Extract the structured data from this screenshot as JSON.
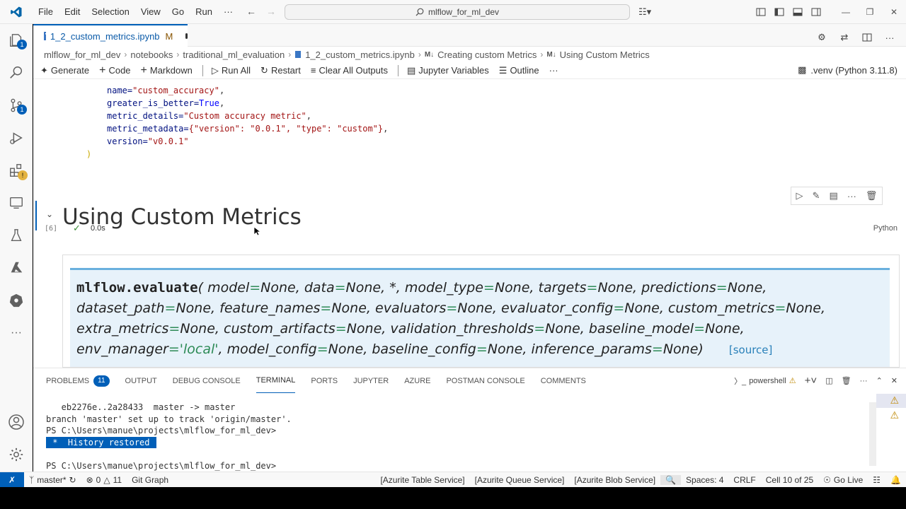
{
  "menu": [
    "File",
    "Edit",
    "Selection",
    "View",
    "Go",
    "Run",
    "···"
  ],
  "search": {
    "text": "mlflow_for_ml_dev"
  },
  "tab": {
    "filename": "1_2_custom_metrics.ipynb",
    "modified": "M"
  },
  "breadcrumb": [
    "mlflow_for_ml_dev",
    "notebooks",
    "traditional_ml_evaluation",
    "1_2_custom_metrics.ipynb",
    "Creating custom Metrics",
    "Using Custom Metrics"
  ],
  "breadcrumb_md_tag": "M↓",
  "nb_toolbar": {
    "generate": "Generate",
    "code": "Code",
    "markdown": "Markdown",
    "run_all": "Run All",
    "restart": "Restart",
    "clear_outputs": "Clear All Outputs",
    "variables": "Jupyter Variables",
    "outline": "Outline",
    "more": "···",
    "kernel": ".venv (Python 3.11.8)"
  },
  "code_cell": {
    "lines": [
      {
        "key": "name=",
        "val": "\"custom_accuracy\"",
        "tail": ","
      },
      {
        "key": "greater_is_better=",
        "val": "True",
        "tail": ","
      },
      {
        "key": "metric_details=",
        "val": "\"Custom accuracy metric\"",
        "tail": ","
      },
      {
        "key": "metric_metadata=",
        "val": "{\"version\": \"0.0.1\", \"type\": \"custom\"}",
        "tail": ","
      },
      {
        "key": "version=",
        "val": "\"v0.0.1\"",
        "tail": ""
      }
    ],
    "closing": ")",
    "exec_count": "[6]",
    "duration": "0.0s",
    "language": "Python"
  },
  "markdown_cell": {
    "heading": "Using Custom Metrics"
  },
  "doc_signature": {
    "func": "mlflow.evaluate",
    "line1": [
      [
        "model",
        "None"
      ],
      [
        "data",
        "None"
      ],
      [
        "*",
        null
      ],
      [
        "model_type",
        "None"
      ],
      [
        "targets",
        "None"
      ],
      [
        "predictions",
        "None"
      ]
    ],
    "line2": [
      [
        "dataset_path",
        "None"
      ],
      [
        "feature_names",
        "None"
      ],
      [
        "evaluators",
        "None"
      ],
      [
        "evaluator_config",
        "None"
      ],
      [
        "custom_metrics",
        "None"
      ]
    ],
    "line3": [
      [
        "extra_metrics",
        "None"
      ],
      [
        "custom_artifacts",
        "None"
      ],
      [
        "validation_thresholds",
        "None"
      ],
      [
        "baseline_model",
        "None"
      ]
    ],
    "line4": [
      [
        "env_manager",
        "'local'"
      ],
      [
        "model_config",
        "None"
      ],
      [
        "baseline_config",
        "None"
      ],
      [
        "inference_params",
        "None"
      ]
    ],
    "source": "[source]"
  },
  "panel": {
    "tabs": [
      "PROBLEMS",
      "OUTPUT",
      "DEBUG CONSOLE",
      "TERMINAL",
      "PORTS",
      "JUPYTER",
      "AZURE",
      "POSTMAN CONSOLE",
      "COMMENTS"
    ],
    "problems_count": "11",
    "active_tab": "TERMINAL",
    "shell": "powershell"
  },
  "terminal": {
    "lines": [
      "   eb2276e..2a28433  master -> master",
      "branch 'master' set up to track 'origin/master'.",
      "PS C:\\Users\\manue\\projects\\mlflow_for_ml_dev>"
    ],
    "history": " *  History restored ",
    "prompt": "PS C:\\Users\\manue\\projects\\mlflow_for_ml_dev>"
  },
  "status": {
    "branch": "master*",
    "errors": "0",
    "warnings": "11",
    "git_graph": "Git Graph",
    "azurite_table": "[Azurite Table Service]",
    "azurite_queue": "[Azurite Queue Service]",
    "azurite_blob": "[Azurite Blob Service]",
    "spaces": "Spaces: 4",
    "eol": "CRLF",
    "cell": "Cell 10 of 25",
    "go_live": "Go Live"
  },
  "badges": {
    "explorer": "1",
    "scm": "1"
  },
  "colors": {
    "accent": "#005fb8",
    "doc_bg": "#e7f2fa",
    "doc_border": "#6ab0de",
    "param_eq": "#2e8b57"
  }
}
